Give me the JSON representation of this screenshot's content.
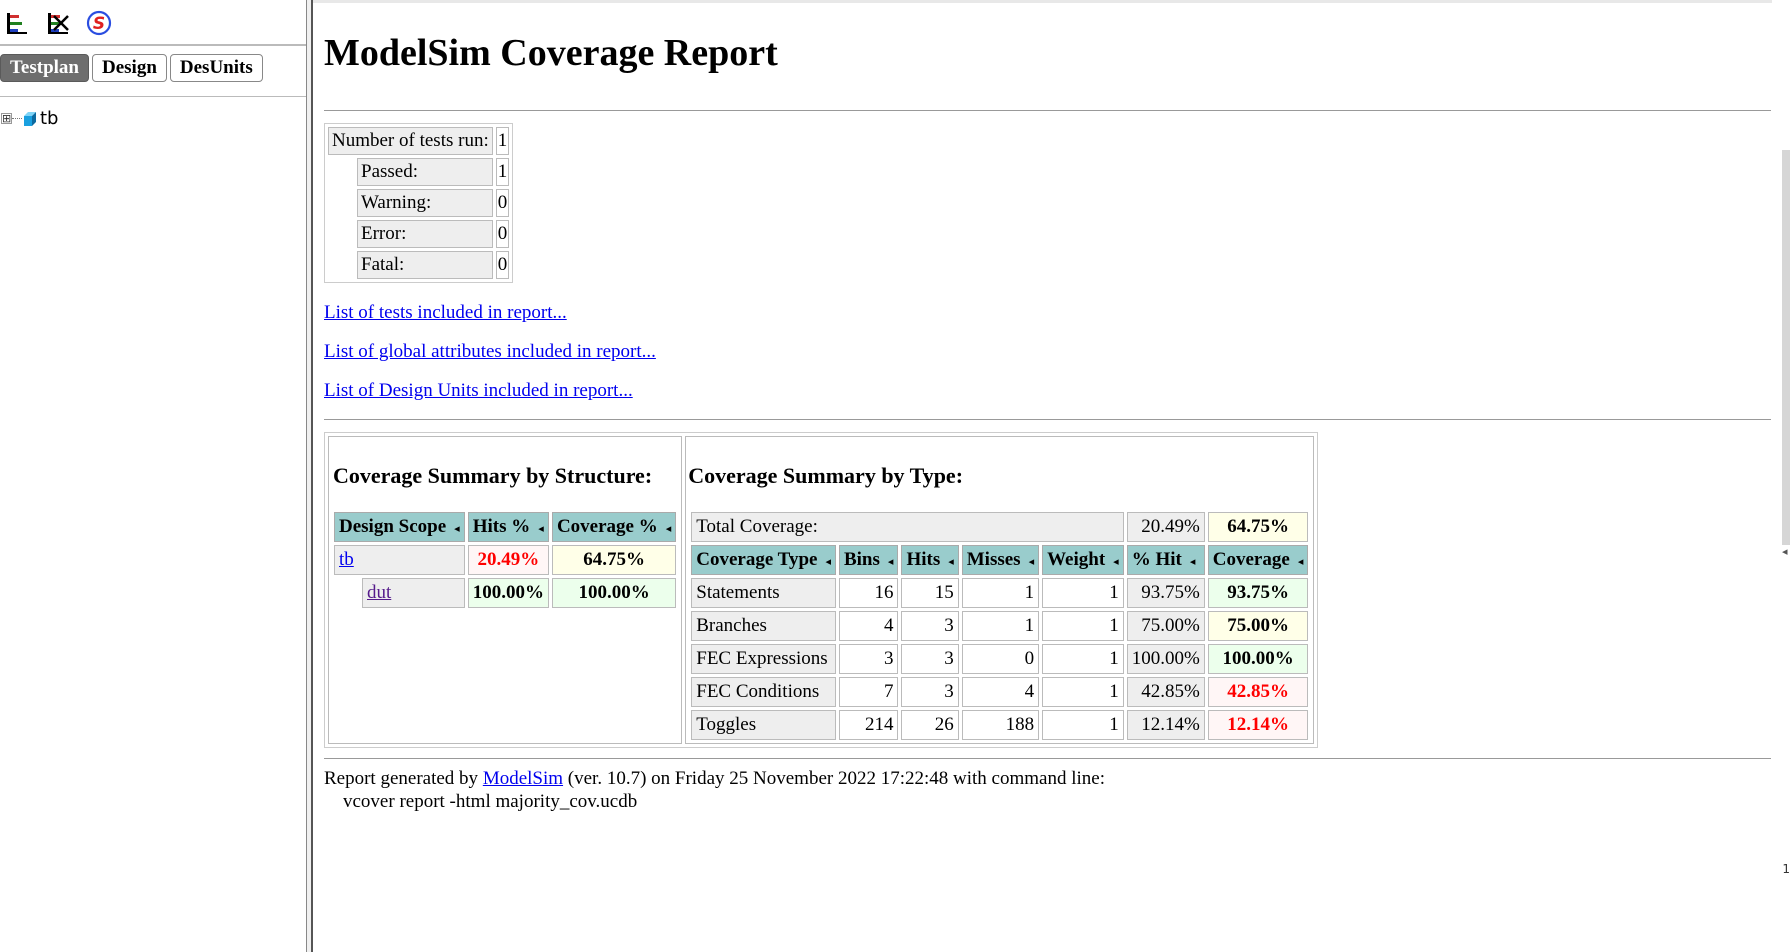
{
  "left": {
    "toolbar": {
      "icons": [
        "tree-expand-icon",
        "tree-collapse-icon",
        "modelsim-logo-icon"
      ],
      "accent": "#2a4de0"
    },
    "tabs": [
      {
        "label": "Testplan",
        "active": true
      },
      {
        "label": "Design",
        "active": false
      },
      {
        "label": "DesUnits",
        "active": false
      }
    ],
    "tree": {
      "expander": "⊞",
      "root": "tb"
    }
  },
  "main": {
    "title": "ModelSim Coverage Report",
    "tests": {
      "rows": [
        {
          "label": "Number of tests run:",
          "value": "1"
        },
        {
          "label": "Passed:",
          "value": "1"
        },
        {
          "label": "Warning:",
          "value": "0"
        },
        {
          "label": "Error:",
          "value": "0"
        },
        {
          "label": "Fatal:",
          "value": "0"
        }
      ]
    },
    "links": {
      "tests": "List of tests included in report...",
      "attributes": "List of global attributes included in report...",
      "design_units": "List of Design Units included in report..."
    },
    "structure": {
      "heading": "Coverage Summary by Structure:",
      "columns": [
        "Design Scope",
        "Hits %",
        "Coverage %"
      ],
      "rows": [
        {
          "scope": "tb",
          "hits": "20.49%",
          "coverage": "64.75%"
        },
        {
          "scope": "dut",
          "hits": "100.00%",
          "coverage": "100.00%"
        }
      ]
    },
    "type": {
      "heading": "Coverage Summary by Type:",
      "total": {
        "label": "Total Coverage:",
        "hit": "20.49%",
        "coverage": "64.75%"
      },
      "columns": [
        "Coverage Type",
        "Bins",
        "Hits",
        "Misses",
        "Weight",
        "% Hit",
        "Coverage"
      ],
      "rows": [
        {
          "type": "Statements",
          "bins": "16",
          "hits": "15",
          "misses": "1",
          "weight": "1",
          "pct": "93.75%",
          "coverage": "93.75%"
        },
        {
          "type": "Branches",
          "bins": "4",
          "hits": "3",
          "misses": "1",
          "weight": "1",
          "pct": "75.00%",
          "coverage": "75.00%"
        },
        {
          "type": "FEC Expressions",
          "bins": "3",
          "hits": "3",
          "misses": "0",
          "weight": "1",
          "pct": "100.00%",
          "coverage": "100.00%"
        },
        {
          "type": "FEC Conditions",
          "bins": "7",
          "hits": "3",
          "misses": "4",
          "weight": "1",
          "pct": "42.85%",
          "coverage": "42.85%"
        },
        {
          "type": "Toggles",
          "bins": "214",
          "hits": "26",
          "misses": "188",
          "weight": "1",
          "pct": "12.14%",
          "coverage": "12.14%"
        }
      ]
    },
    "footer": {
      "prefix": "Report generated by ",
      "link": "ModelSim",
      "suffix": " (ver. 10.7) on Friday 25 November 2022 17:22:48 with command line:",
      "command": "vcover report -html majority_cov.ucdb"
    }
  },
  "scrollbar": {
    "marker": "◂",
    "page": "1"
  },
  "colors": {
    "header_bg": "#99cccc",
    "low": "#ff0000",
    "link": "#0000ee",
    "visited": "#551a8b",
    "tab_active": "#6e6e6e"
  }
}
